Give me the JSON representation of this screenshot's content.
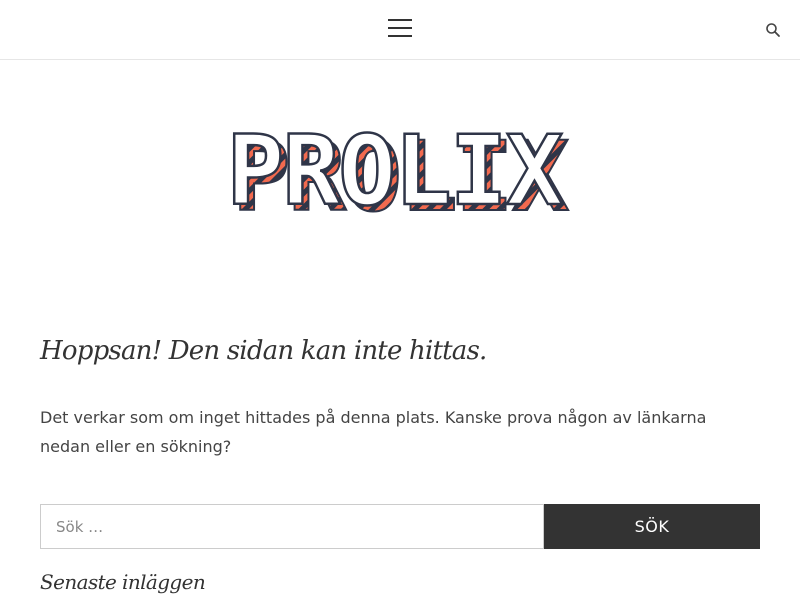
{
  "header": {
    "menu_icon": "hamburger-menu-icon",
    "search_icon": "search-icon"
  },
  "logo": {
    "text": "PROLIX",
    "colors": {
      "stripe_a": "#f26a4f",
      "stripe_b": "#2f3548",
      "fill": "#ffffff",
      "outline": "#2f3548"
    }
  },
  "content": {
    "title": "Hoppsan! Den sidan kan inte hittas.",
    "message": "Det verkar som om inget hittades på denna plats. Kanske prova någon av länkarna nedan eller en sökning?"
  },
  "search": {
    "placeholder": "Sök …",
    "value": "",
    "button_label": "SÖK"
  },
  "widgets": {
    "recent_posts_title": "Senaste inläggen"
  }
}
